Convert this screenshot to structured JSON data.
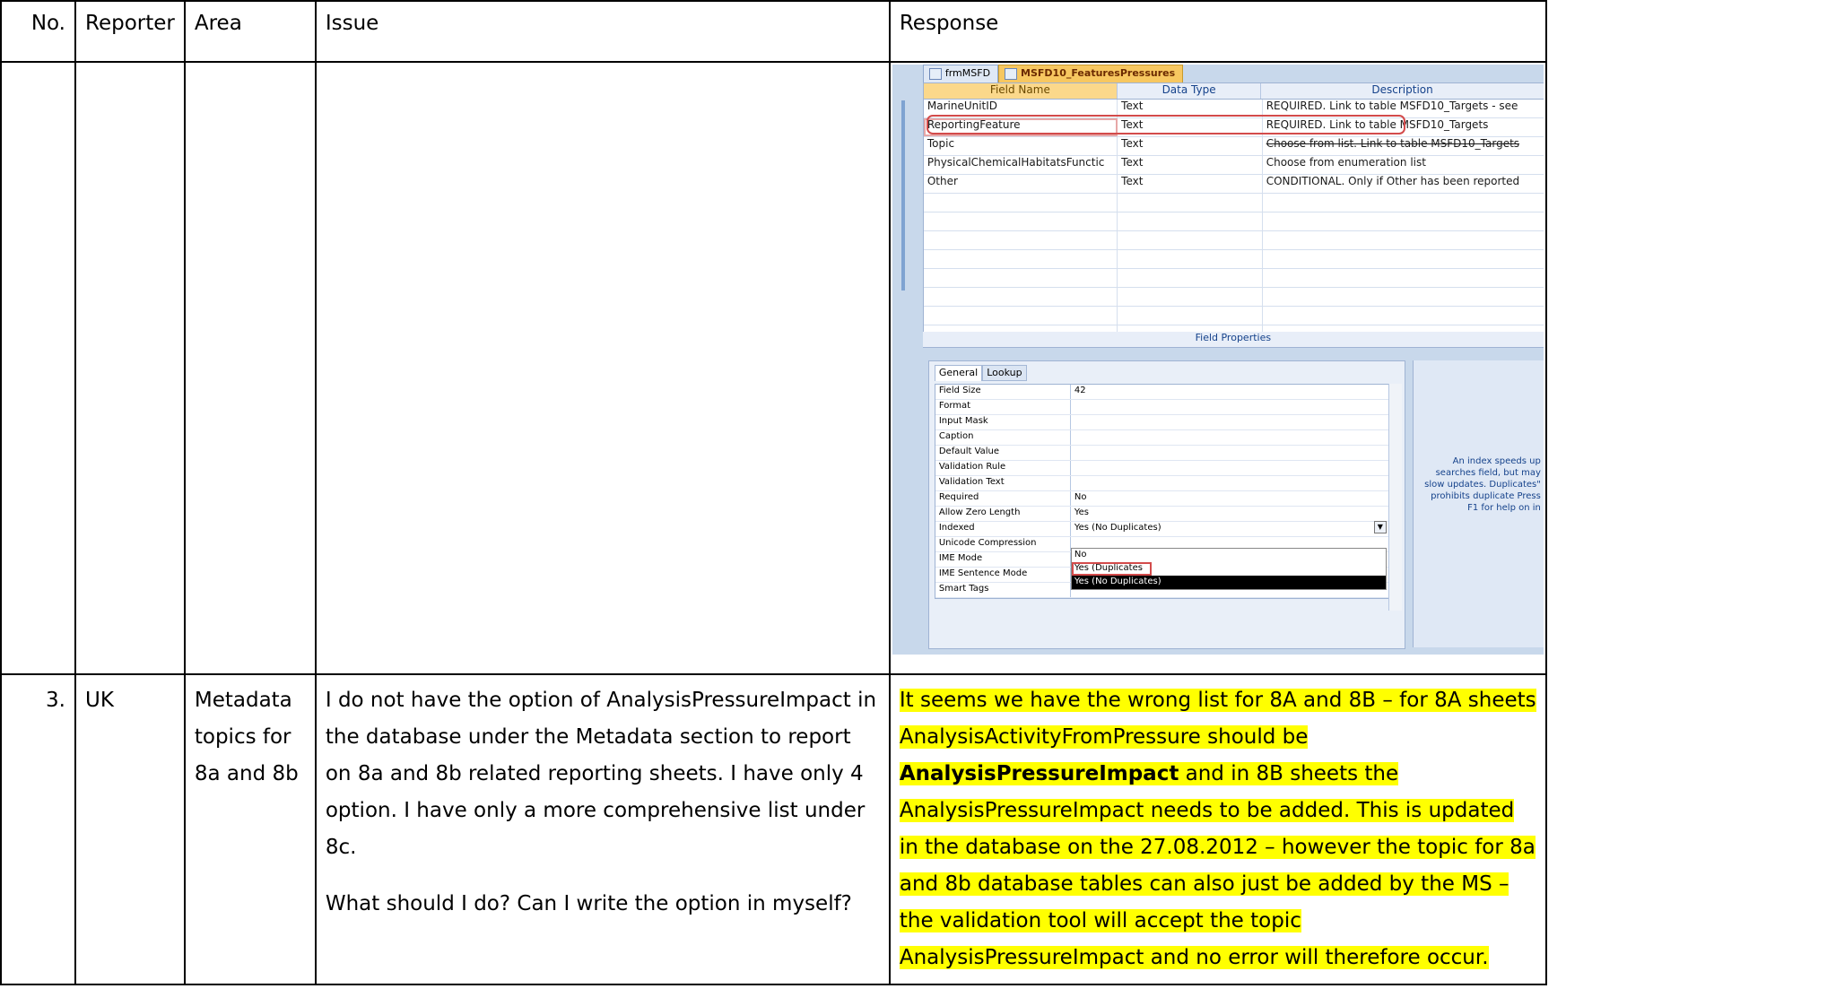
{
  "headers": {
    "no": "No.",
    "reporter": "Reporter",
    "area": "Area",
    "issue": "Issue",
    "response": "Response"
  },
  "access": {
    "tab1": "frmMSFD",
    "tab2": "MSFD10_FeaturesPressures",
    "col_headers": {
      "field": "Field Name",
      "type": "Data Type",
      "desc": "Description"
    },
    "rows": [
      {
        "field": "MarineUnitID",
        "type": "Text",
        "desc": "REQUIRED. Link to table MSFD10_Targets - see"
      },
      {
        "field": "ReportingFeature",
        "type": "Text",
        "desc": "REQUIRED. Link to table MSFD10_Targets"
      },
      {
        "field": "Topic",
        "type": "Text",
        "desc": "Choose from list. Link to table MSFD10_Targets"
      },
      {
        "field": "PhysicalChemicalHabitatsFunctic",
        "type": "Text",
        "desc": "Choose from enumeration list"
      },
      {
        "field": "Other",
        "type": "Text",
        "desc": "CONDITIONAL. Only if Other has been reported"
      }
    ],
    "field_properties": "Field Properties",
    "prop_tabs": [
      "General",
      "Lookup"
    ],
    "props": [
      {
        "label": "Field Size",
        "value": "42"
      },
      {
        "label": "Format",
        "value": ""
      },
      {
        "label": "Input Mask",
        "value": ""
      },
      {
        "label": "Caption",
        "value": ""
      },
      {
        "label": "Default Value",
        "value": ""
      },
      {
        "label": "Validation Rule",
        "value": ""
      },
      {
        "label": "Validation Text",
        "value": ""
      },
      {
        "label": "Required",
        "value": "No"
      },
      {
        "label": "Allow Zero Length",
        "value": "Yes"
      },
      {
        "label": "Indexed",
        "value": "Yes (No Duplicates)"
      },
      {
        "label": "Unicode Compression",
        "value": ""
      },
      {
        "label": "IME Mode",
        "value": ""
      },
      {
        "label": "IME Sentence Mode",
        "value": ""
      },
      {
        "label": "Smart Tags",
        "value": ""
      }
    ],
    "dropdown": [
      "No",
      "Yes (Duplicates OK)",
      "Yes (No Duplicates)"
    ],
    "help_text": "An index speeds up searches field, but may slow updates. Duplicates\" prohibits duplicate Press F1 for help on in"
  },
  "row3": {
    "no": "3.",
    "reporter": "UK",
    "area": "Metadata topics for 8a and 8b",
    "issue_p1": "I do not have the option of AnalysisPressureImpact in the database under the Metadata section to report on 8a and 8b related reporting sheets. I have only 4 option.  I have only a more comprehensive list under 8c.",
    "issue_p2": "What should I do? Can I write the option in myself?",
    "response_a": "It seems we have the wrong list for 8A and 8B – for 8A sheets AnalysisActivityFromPressure should be ",
    "response_bold": "AnalysisPressureImpact",
    "response_b": " and in 8B sheets the AnalysisPressureImpact needs to be added. This is updated in the database on the 27.08.2012 – however the topic for 8a and 8b database tables can also just be added by the MS – the validation tool will accept the topic AnalysisPressureImpact and no error will therefore occur."
  }
}
